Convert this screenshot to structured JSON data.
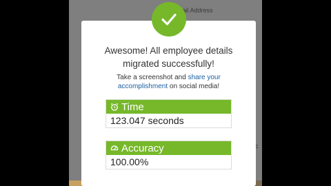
{
  "background": {
    "field_label": "...ail Address",
    "right_fragment": "c"
  },
  "modal": {
    "headline": "Awesome! All employee details migrated successfully!",
    "sub_prefix": "Take a screenshot and ",
    "sub_link": "share your accomplishment",
    "sub_suffix": " on social media!",
    "success_icon": "checkmark-icon"
  },
  "time": {
    "title": "Time",
    "icon": "alarm-clock-icon",
    "value": "123.047 seconds"
  },
  "accuracy": {
    "title": "Accuracy",
    "icon": "gauge-icon",
    "value": "100.00%"
  },
  "colors": {
    "accent": "#76b82a",
    "link": "#1a5fa0"
  }
}
